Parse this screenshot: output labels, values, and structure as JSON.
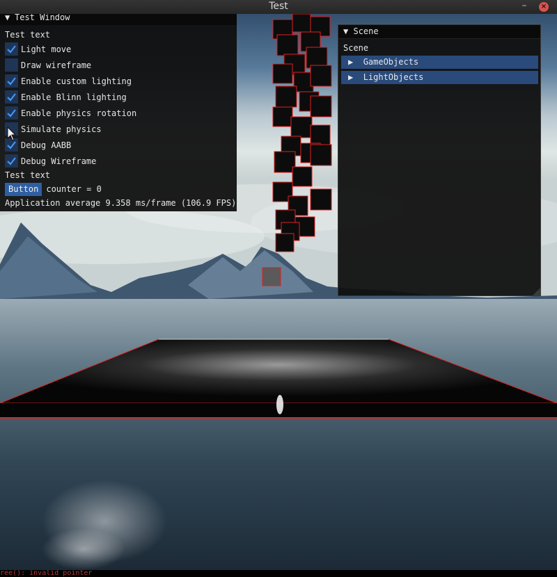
{
  "titlebar": {
    "title": "Test",
    "minimize_glyph": "–",
    "close_glyph": "×"
  },
  "test_window": {
    "title": "Test Window",
    "collapse_glyph": "▼",
    "text1": "Test text",
    "checkboxes": [
      {
        "label": "Light move",
        "checked": true
      },
      {
        "label": "Draw wireframe",
        "checked": false
      },
      {
        "label": "Enable custom lighting",
        "checked": true
      },
      {
        "label": "Enable Blinn lighting",
        "checked": true
      },
      {
        "label": "Enable physics rotation",
        "checked": true
      },
      {
        "label": "Simulate physics",
        "checked": false
      },
      {
        "label": "Debug AABB",
        "checked": true
      },
      {
        "label": "Debug Wireframe",
        "checked": true
      }
    ],
    "text2": "Test text",
    "button_label": "Button",
    "counter_text": "counter = 0",
    "fps_text": "Application average 9.358 ms/frame (106.9 FPS)"
  },
  "scene_window": {
    "title": "Scene",
    "collapse_glyph": "▼",
    "header": "Scene",
    "nodes": [
      {
        "label": "GameObjects",
        "glyph": "▶"
      },
      {
        "label": "LightObjects",
        "glyph": "▶"
      }
    ]
  },
  "console": {
    "text": "ree(): invalid pointer"
  },
  "colors": {
    "checkbox_bg": "#1f3556",
    "checkmark": "#4296fa",
    "button": "#2f5fa0",
    "tree_node": "#294a7a",
    "debug_red": "#e01f1f"
  },
  "icons": [
    "collapse-arrow-icon",
    "checkmark-icon",
    "tree-expand-icon",
    "mouse-cursor-icon",
    "close-icon",
    "minimize-icon"
  ]
}
